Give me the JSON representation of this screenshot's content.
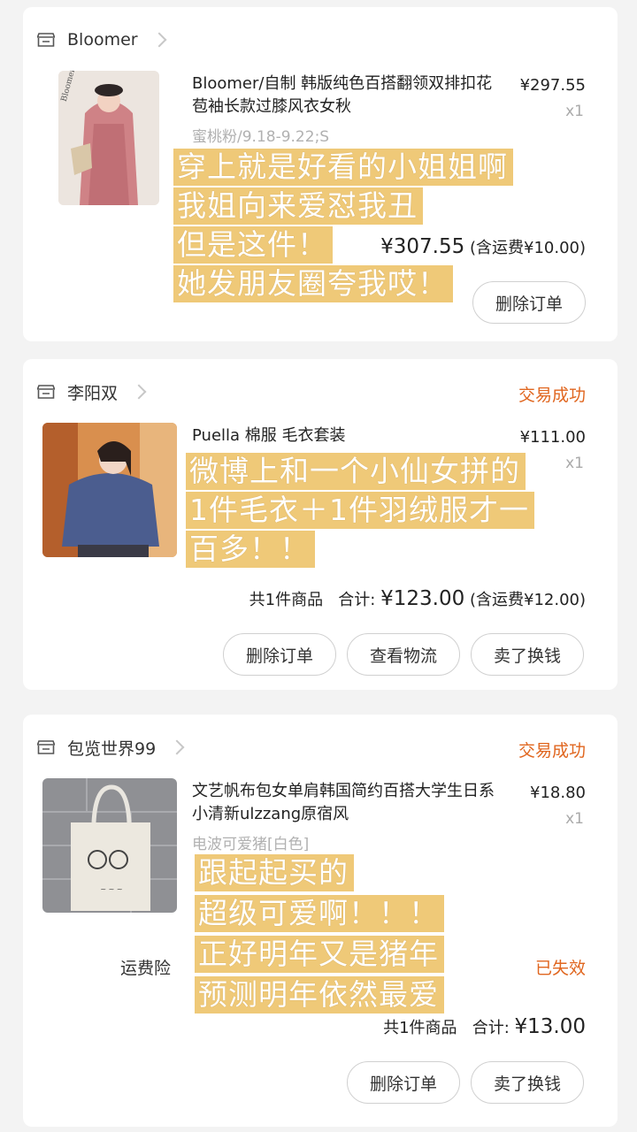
{
  "orders": [
    {
      "shop": "Bloomer",
      "title": "Bloomer/自制 韩版纯色百搭翻领双排扣花苞袖长款过膝风衣女秋",
      "price": "¥297.55",
      "qty": "x1",
      "variant": "蜜桃粉/9.18-9.22;S",
      "total": "¥307.55",
      "shipping": "(含运费¥10.00)",
      "buttons": [
        "删除订单"
      ],
      "captions": [
        "穿上就是好看的小姐姐啊",
        "我姐向来爱怼我丑",
        "但是这件！",
        "她发朋友圈夸我哎！"
      ]
    },
    {
      "shop": "李阳双",
      "status": "交易成功",
      "title": "Puella 棉服 毛衣套装",
      "price": "¥111.00",
      "qty": "x1",
      "count_label": "共1件商品",
      "total_label": "合计:",
      "total": "¥123.00",
      "shipping": "(含运费¥12.00)",
      "buttons": [
        "删除订单",
        "查看物流",
        "卖了换钱"
      ],
      "captions": [
        "微博上和一个小仙女拼的",
        "1件毛衣＋1件羽绒服才一",
        "百多！！"
      ]
    },
    {
      "shop": "包览世界99",
      "status": "交易成功",
      "title": "文艺帆布包女单肩韩国简约百搭大学生日系小清新ulzzang原宿风",
      "price": "¥18.80",
      "qty": "x1",
      "variant": "电波可爱猪[白色]",
      "insurance_label": "运费险",
      "insurance_status": "已失效",
      "count_label": "共1件商品",
      "total_label": "合计:",
      "total": "¥13.00",
      "buttons": [
        "删除订单",
        "卖了换钱"
      ],
      "captions": [
        "跟起起买的",
        "超级可爱啊！！！",
        "正好明年又是猪年",
        "预测明年依然最爱"
      ]
    }
  ],
  "colors": {
    "status": "#e0661f",
    "caption_bg": "#eec46d",
    "page_bg": "#f3f3f3"
  }
}
